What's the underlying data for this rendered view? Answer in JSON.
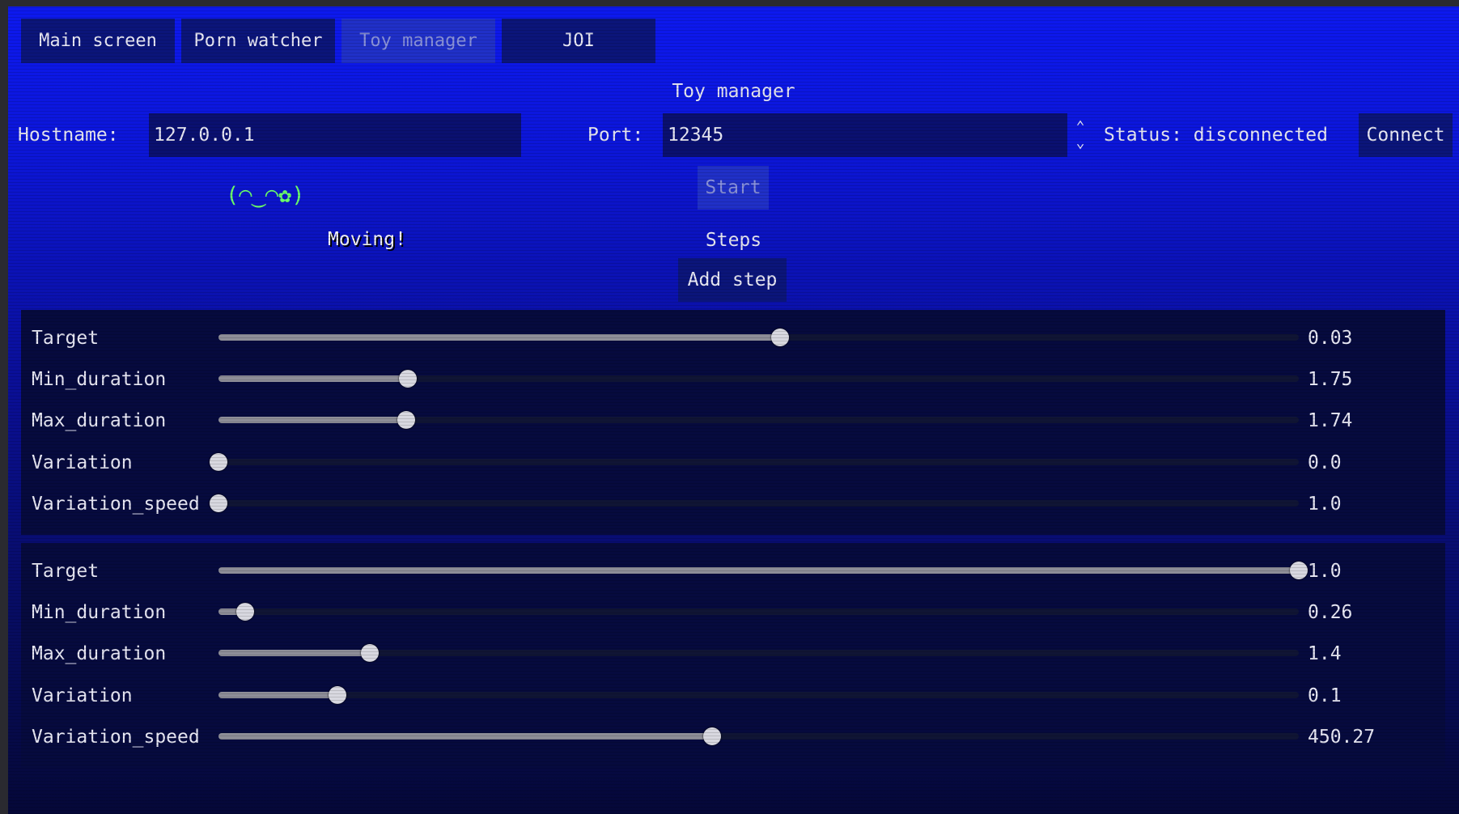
{
  "tabs": [
    {
      "label": "Main screen",
      "disabled": false
    },
    {
      "label": "Porn watcher",
      "disabled": false
    },
    {
      "label": "Toy manager",
      "disabled": true
    },
    {
      "label": "JOI",
      "disabled": false
    }
  ],
  "page": {
    "title": "Toy manager",
    "hostname_label": "Hostname:",
    "hostname_value": "127.0.0.1",
    "port_label": "Port:",
    "port_value": "12345",
    "status_text": "Status: disconnected",
    "connect_label": "Connect",
    "start_label": "Start",
    "kaomoji": "(◠‿◠✿)",
    "moving_text": "Moving!",
    "steps_label": "Steps",
    "add_step_label": "Add step"
  },
  "steps": [
    {
      "sliders": [
        {
          "name": "Target",
          "value": "0.03",
          "fill": 0.52
        },
        {
          "name": "Min_duration",
          "value": "1.75",
          "fill": 0.175
        },
        {
          "name": "Max_duration",
          "value": "1.74",
          "fill": 0.174
        },
        {
          "name": "Variation",
          "value": "0.0",
          "fill": 0.0
        },
        {
          "name": "Variation_speed",
          "value": "1.0",
          "fill": 0.0
        }
      ]
    },
    {
      "sliders": [
        {
          "name": "Target",
          "value": "1.0",
          "fill": 1.0
        },
        {
          "name": "Min_duration",
          "value": "0.26",
          "fill": 0.025
        },
        {
          "name": "Max_duration",
          "value": "1.4",
          "fill": 0.14
        },
        {
          "name": "Variation",
          "value": "0.1",
          "fill": 0.11
        },
        {
          "name": "Variation_speed",
          "value": "450.27",
          "fill": 0.457
        }
      ]
    }
  ],
  "colors": {
    "accent_green": "#6bff6b",
    "button_bg": "#0b157a",
    "panel_bg": "#060a3e"
  }
}
